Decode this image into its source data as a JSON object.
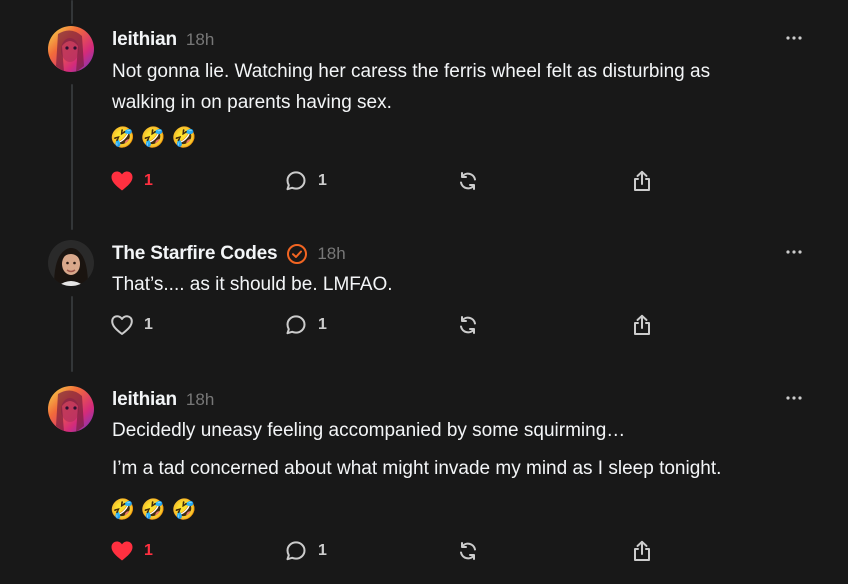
{
  "posts": [
    {
      "username": "leithian",
      "time": "18h",
      "verified": false,
      "lines": [
        "Not gonna lie. Watching her caress the ferris wheel felt as disturbing as",
        "walking in on parents having sex."
      ],
      "emojis": "🤣🤣🤣",
      "liked": true,
      "like_count": "1",
      "reply_count": "1"
    },
    {
      "username": "The Starfire Codes",
      "time": "18h",
      "verified": true,
      "lines": [
        "That’s.... as it should be. LMFAO."
      ],
      "emojis": "",
      "liked": false,
      "like_count": "1",
      "reply_count": "1"
    },
    {
      "username": "leithian",
      "time": "18h",
      "verified": false,
      "lines": [
        "Decidedly uneasy feeling accompanied by some squirming…",
        "I’m a tad concerned about what might invade my mind as I sleep tonight."
      ],
      "emojis": "🤣🤣🤣",
      "liked": true,
      "like_count": "1",
      "reply_count": "1"
    }
  ],
  "icons": {
    "like": "heart-icon",
    "reply": "comment-icon",
    "repost": "repost-icon",
    "share": "share-icon",
    "more": "more-icon",
    "verified": "verified-badge-icon"
  },
  "colors": {
    "background": "#181818",
    "like_active": "#ff3040",
    "verified": "#f26522",
    "muted": "#777777"
  }
}
